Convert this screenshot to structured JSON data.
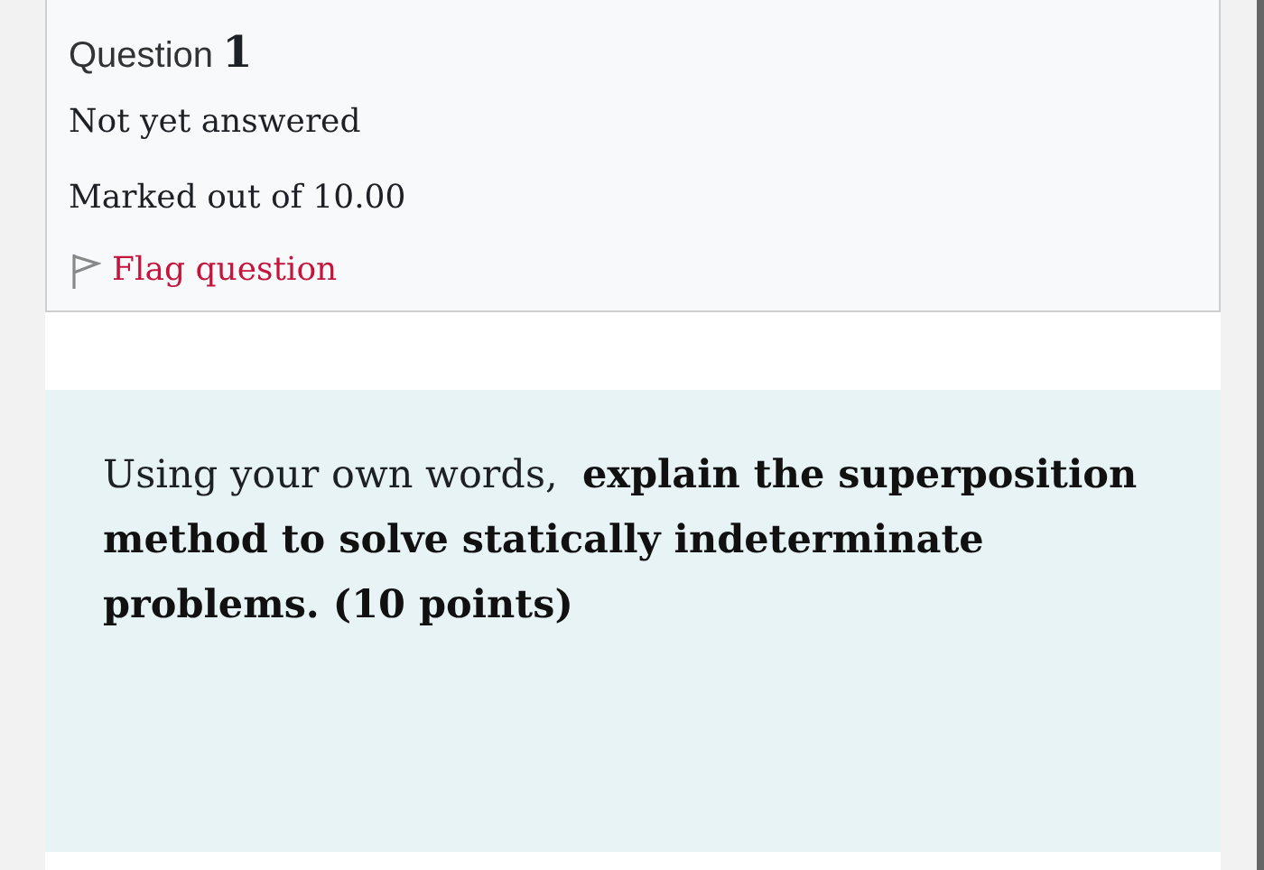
{
  "info": {
    "label": "Question",
    "number": "1",
    "status": "Not yet answered",
    "marks": "Marked out of 10.00",
    "flag": {
      "label": "Flag question",
      "flagged": false
    }
  },
  "question": {
    "text": "Using your own words,  **explain the superposition method to solve statically indeterminate problems. (10 points)**"
  }
}
